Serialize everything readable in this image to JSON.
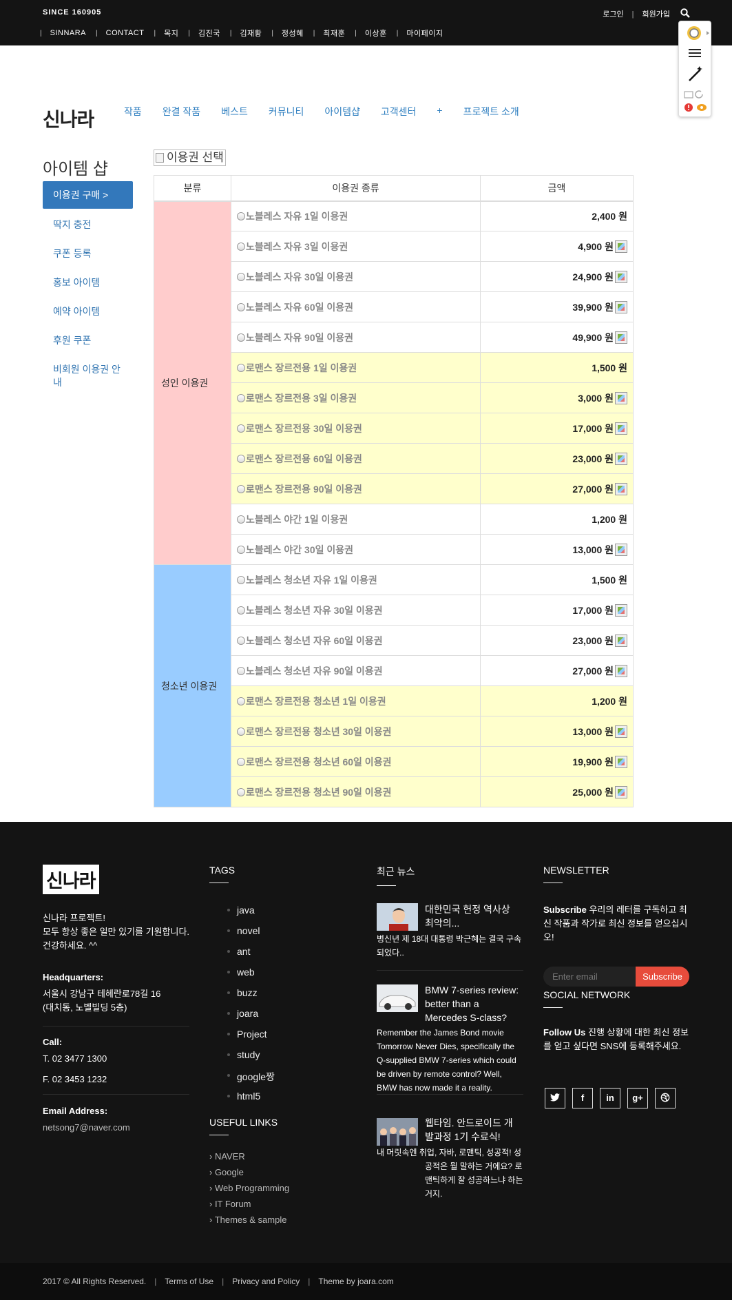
{
  "topbar": {
    "since": "SINCE 160905",
    "login": "로그인",
    "signup": "회원가입",
    "nav": [
      "SINNARA",
      "CONTACT",
      "목지",
      "김진국",
      "김재황",
      "정성혜",
      "최재훈",
      "이상훈",
      "마이페이지"
    ]
  },
  "header": {
    "logo": "신나라",
    "nav": [
      "작품",
      "완결 작품",
      "베스트",
      "커뮤니티",
      "아이템샵",
      "고객센터",
      "+",
      "프로젝트 소개"
    ]
  },
  "sidebar": {
    "title": "아이템 샵",
    "active": "이용권 구매 >",
    "items": [
      "딱지 충전",
      "쿠폰 등록",
      "홍보 아이템",
      "예약 아이템",
      "후원 쿠폰",
      "비회원 이용권 안내"
    ]
  },
  "content": {
    "select_alt": "이용권 선택",
    "headers": [
      "분류",
      "이용권 종류",
      "금액"
    ],
    "groups": [
      {
        "category": "성인 이용권",
        "color": "#ffcccc",
        "rows": [
          {
            "name": "노블레스 자유 1일 이용권",
            "price": "2,400 원",
            "badge": false,
            "yellow": false
          },
          {
            "name": "노블레스 자유 3일 이용권",
            "price": "4,900 원",
            "badge": true,
            "yellow": false
          },
          {
            "name": "노블레스 자유 30일 이용권",
            "price": "24,900 원",
            "badge": true,
            "yellow": false
          },
          {
            "name": "노블레스 자유 60일 이용권",
            "price": "39,900 원",
            "badge": true,
            "yellow": false
          },
          {
            "name": "노블레스 자유 90일 이용권",
            "price": "49,900 원",
            "badge": true,
            "yellow": false
          },
          {
            "name": "로맨스 장르전용 1일 이용권",
            "price": "1,500 원",
            "badge": false,
            "yellow": true
          },
          {
            "name": "로맨스 장르전용 3일 이용권",
            "price": "3,000 원",
            "badge": true,
            "yellow": true
          },
          {
            "name": "로맨스 장르전용 30일 이용권",
            "price": "17,000 원",
            "badge": true,
            "yellow": true
          },
          {
            "name": "로맨스 장르전용 60일 이용권",
            "price": "23,000 원",
            "badge": true,
            "yellow": true
          },
          {
            "name": "로맨스 장르전용 90일 이용권",
            "price": "27,000 원",
            "badge": true,
            "yellow": true
          },
          {
            "name": "노블레스 야간 1일 이용권",
            "price": "1,200 원",
            "badge": false,
            "yellow": false
          },
          {
            "name": "노블레스 야간 30일 이용권",
            "price": "13,000 원",
            "badge": true,
            "yellow": false
          }
        ]
      },
      {
        "category": "청소년 이용권",
        "color": "#99ccff",
        "rows": [
          {
            "name": "노블레스 청소년 자유 1일 이용권",
            "price": "1,500 원",
            "badge": false,
            "yellow": false
          },
          {
            "name": "노블레스 청소년 자유 30일 이용권",
            "price": "17,000 원",
            "badge": true,
            "yellow": false
          },
          {
            "name": "노블레스 청소년 자유 60일 이용권",
            "price": "23,000 원",
            "badge": true,
            "yellow": false
          },
          {
            "name": "노블레스 청소년 자유 90일 이용권",
            "price": "27,000 원",
            "badge": true,
            "yellow": false
          },
          {
            "name": "로맨스 장르전용 청소년 1일 이용권",
            "price": "1,200 원",
            "badge": false,
            "yellow": true
          },
          {
            "name": "로맨스 장르전용 청소년 30일 이용권",
            "price": "13,000 원",
            "badge": true,
            "yellow": true
          },
          {
            "name": "로맨스 장르전용 청소년 60일 이용권",
            "price": "19,900 원",
            "badge": true,
            "yellow": true
          },
          {
            "name": "로맨스 장르전용 청소년 90일 이용권",
            "price": "25,000 원",
            "badge": true,
            "yellow": true
          }
        ]
      }
    ]
  },
  "footer": {
    "logo": "신나라",
    "about": [
      "신나라 프로젝트!",
      "모두 항상 좋은 일만 있기를 기원합니다.",
      "건강하세요. ^^"
    ],
    "hq_label": "Headquarters:",
    "hq_address": [
      "서울시 강남구 테헤란로78길 16",
      "(대치동, 노벨빌딩 5층)"
    ],
    "call_label": "Call:",
    "phone": "T. 02 3477 1300",
    "fax": "F. 02 3453 1232",
    "email_label": "Email Address:",
    "email": "netsong7@naver.com",
    "tags_title": "TAGS",
    "tags": [
      "java",
      "novel",
      "ant",
      "web",
      "buzz",
      "joara",
      "Project",
      "study",
      "google짱",
      "html5"
    ],
    "links_title": "USEFUL LINKS",
    "links": [
      "› NAVER",
      "› Google",
      "› Web Programming",
      "› IT Forum",
      "› Themes & sample"
    ],
    "news_title": "최근 뉴스",
    "news": [
      {
        "title": "대한민국 헌정 역사상 최악의...",
        "body": "병신년 제 18대 대통령 박근혜는 결국 구속 되었다.."
      },
      {
        "title": "BMW 7-series review: better than a Mercedes S-class?",
        "body": "Remember the James Bond movie Tomorrow Never Dies, specifically the Q-supplied BMW 7-series which could be driven by remote control? Well, BMW has now made it a reality."
      },
      {
        "title": "웹타임. 안드로이드 개발과정 1기 수료식!",
        "body": "내 머릿속엔 취업, 자바, 로맨틱, 성공적! 성공적은 뭘 말하는 거에요? 로맨틱하게 잘 성공하느냐 하는거지."
      }
    ],
    "newsletter_title": "NEWSLETTER",
    "newsletter_bold": "Subscribe",
    "newsletter_text": " 우리의 레터를 구독하고 최신 작품과 작가로 최신 정보를 얻으십시오!",
    "email_placeholder": "Enter email",
    "subscribe": "Subscribe",
    "social_title": "SOCIAL NETWORK",
    "social_bold": "Follow Us",
    "social_text": " 진행 상황에 대한 최신 정보를 얻고 싶다면 SNS에 등록해주세요.",
    "social_icons": [
      "twitter-icon",
      "facebook-icon",
      "linkedin-icon",
      "google-plus-icon",
      "dribbble-icon"
    ]
  },
  "copyright": {
    "text": "2017 © All Rights Reserved.",
    "terms": "Terms of Use",
    "privacy": "Privacy and Policy",
    "theme": "Theme by joara.com"
  }
}
